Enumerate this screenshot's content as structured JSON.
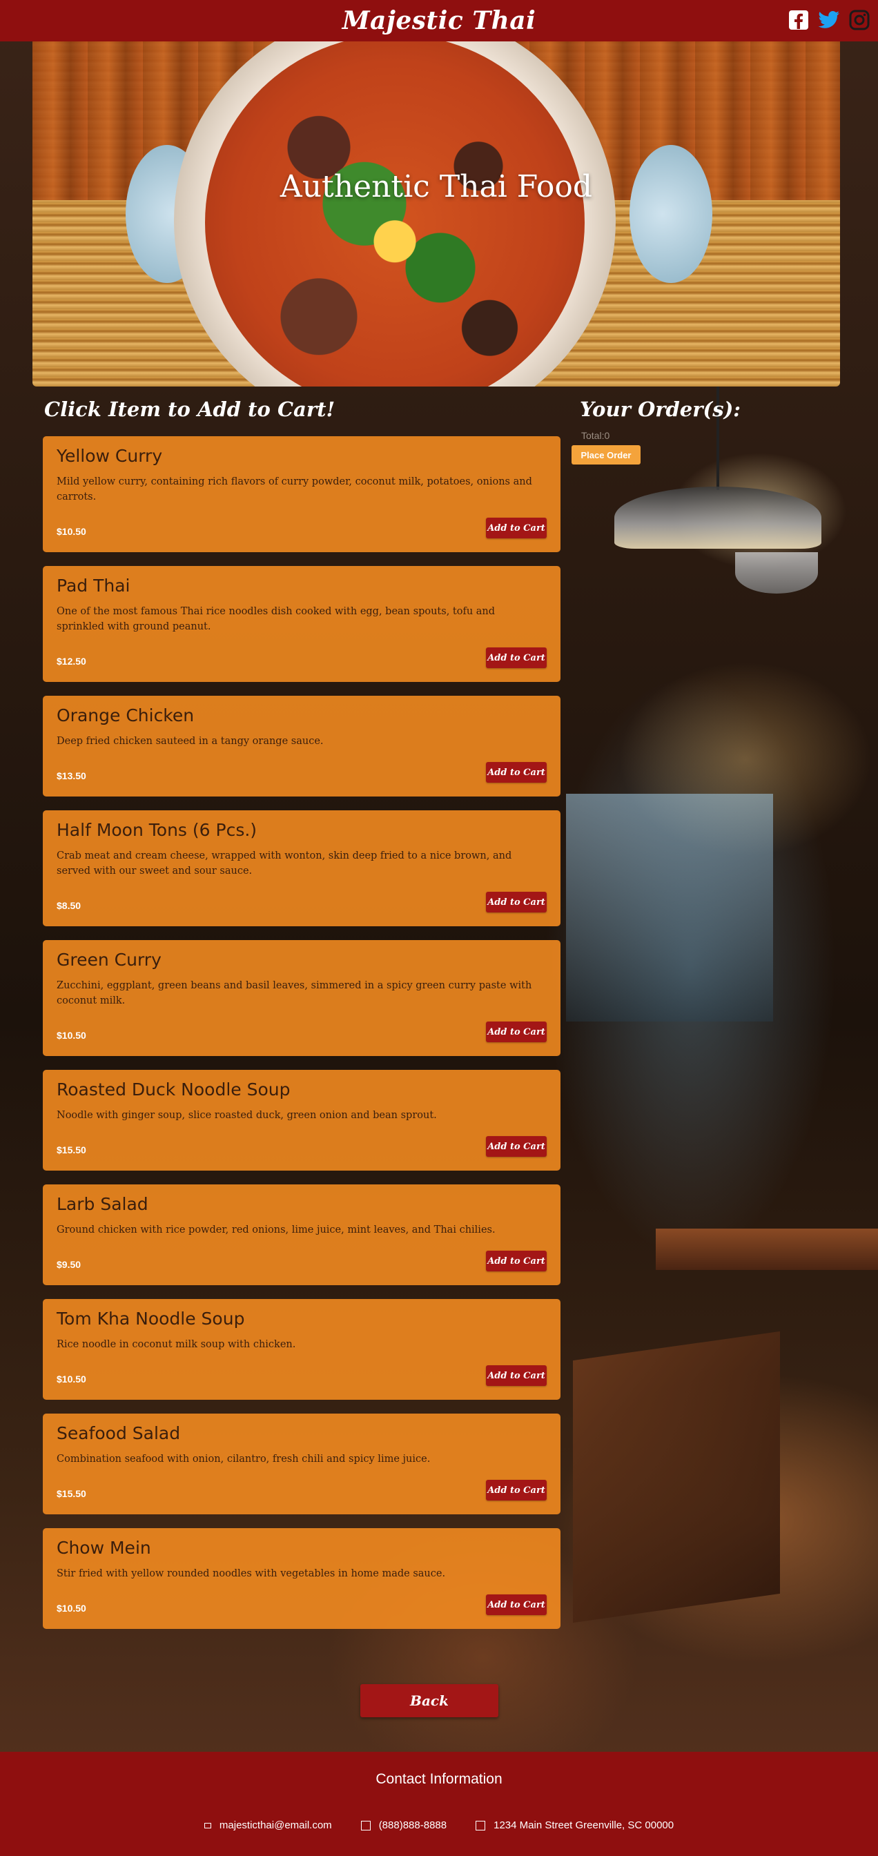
{
  "header": {
    "brand": "Majestic Thai",
    "social": [
      {
        "icon": "facebook-icon"
      },
      {
        "icon": "twitter-icon"
      },
      {
        "icon": "instagram-icon"
      }
    ]
  },
  "hero": {
    "title": "Authentic Thai Food"
  },
  "menu": {
    "heading": "Click Item to Add to Cart!",
    "add_label": "Add to Cart",
    "items": [
      {
        "name": "Yellow Curry",
        "desc": "Mild yellow curry, containing rich flavors of curry powder, coconut milk, potatoes, onions and carrots.",
        "price": "$10.50"
      },
      {
        "name": "Pad Thai",
        "desc": "One of the most famous Thai rice noodles dish cooked with egg, bean spouts, tofu and sprinkled with ground peanut.",
        "price": "$12.50"
      },
      {
        "name": "Orange Chicken",
        "desc": "Deep fried chicken sauteed in a tangy orange sauce.",
        "price": "$13.50"
      },
      {
        "name": "Half Moon Tons (6 Pcs.)",
        "desc": "Crab meat and cream cheese, wrapped with wonton, skin deep fried to a nice brown, and served with our sweet and sour sauce.",
        "price": "$8.50"
      },
      {
        "name": "Green Curry",
        "desc": "Zucchini, eggplant, green beans and basil leaves, simmered in a spicy green curry paste with coconut milk.",
        "price": "$10.50"
      },
      {
        "name": "Roasted Duck Noodle Soup",
        "desc": "Noodle with ginger soup, slice roasted duck, green onion and bean sprout.",
        "price": "$15.50"
      },
      {
        "name": "Larb Salad",
        "desc": "Ground chicken with rice powder, red onions, lime juice, mint leaves, and Thai chilies.",
        "price": "$9.50"
      },
      {
        "name": "Tom Kha Noodle Soup",
        "desc": "Rice noodle in coconut milk soup with chicken.",
        "price": "$10.50"
      },
      {
        "name": "Seafood Salad",
        "desc": "Combination seafood with onion, cilantro, fresh chili and spicy lime juice.",
        "price": "$15.50"
      },
      {
        "name": "Chow Mein",
        "desc": "Stir fried with yellow rounded noodles with vegetables in home made sauce.",
        "price": "$10.50"
      }
    ]
  },
  "order": {
    "heading": "Your Order(s):",
    "total": "Total:0",
    "place_order": "Place Order"
  },
  "back_label": "Back",
  "footer": {
    "title": "Contact Information",
    "email": "majesticthai@email.com",
    "phone": "(888)888-8888",
    "address": "1234 Main Street Greenville, SC 00000"
  },
  "colors": {
    "header": "#8f0f0f",
    "card": "#f68c20",
    "button": "#a31616",
    "place_order": "#f4a33b"
  }
}
